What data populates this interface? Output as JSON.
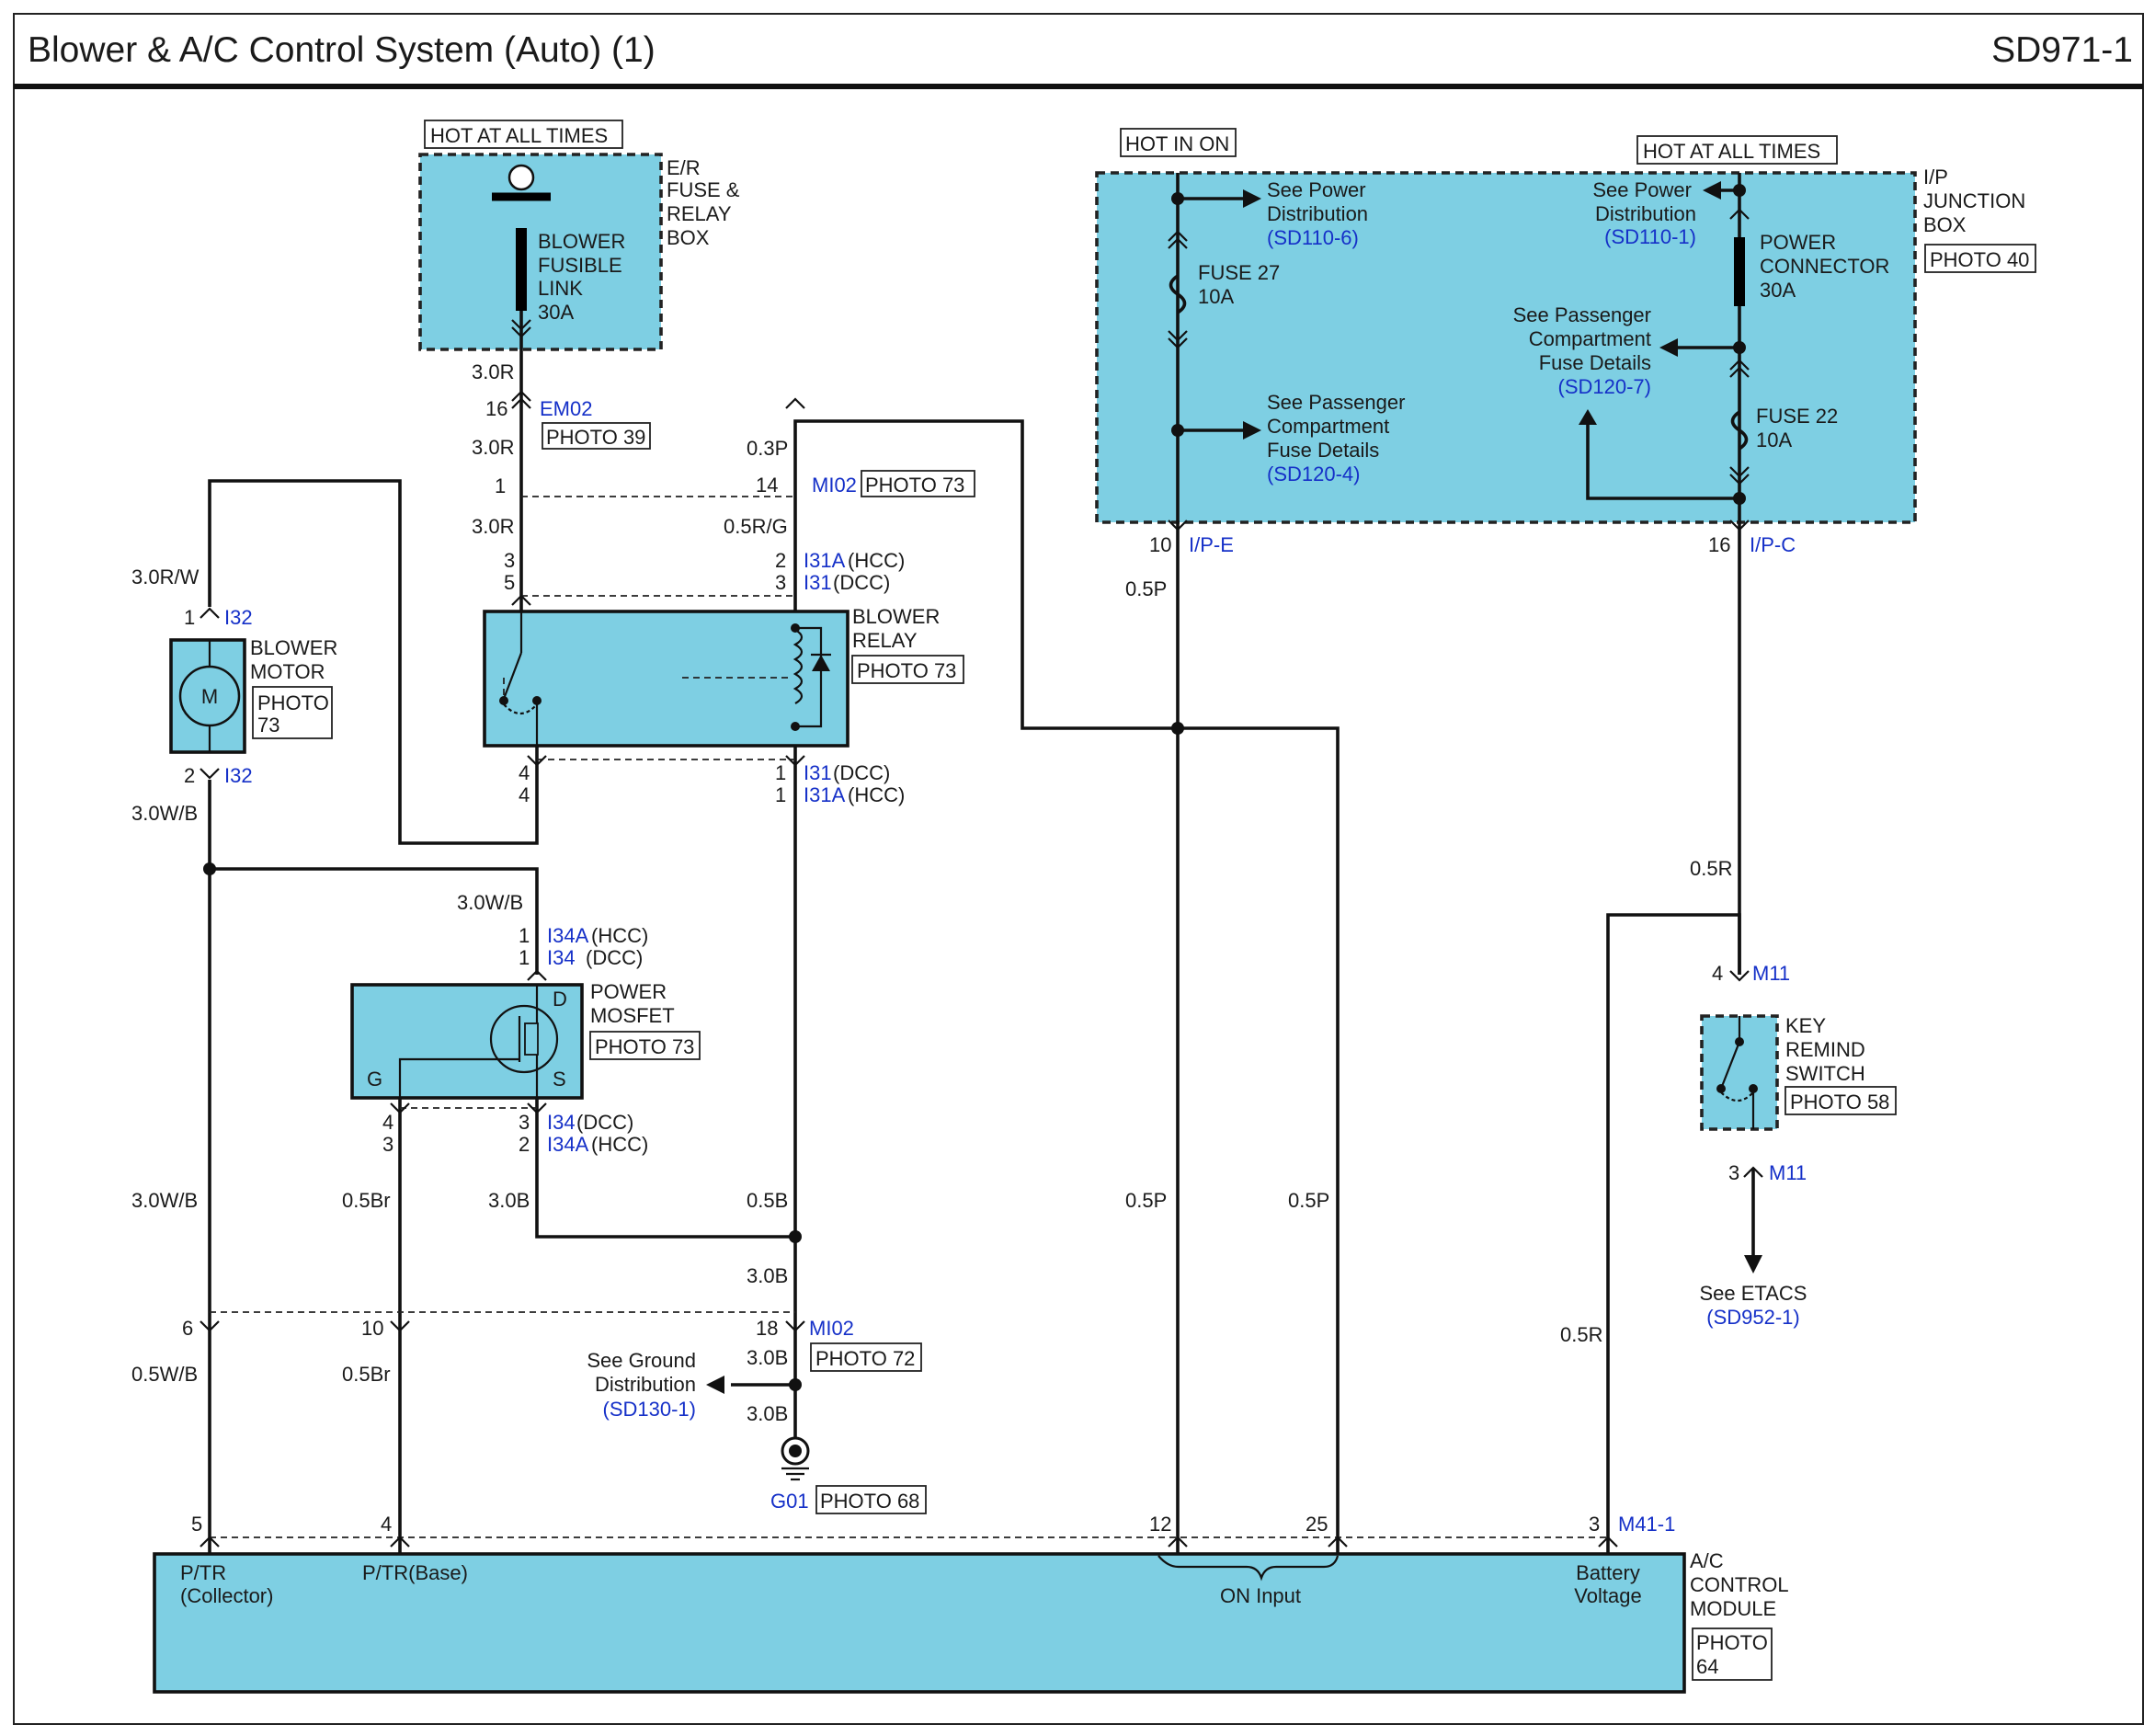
{
  "header": {
    "title": "Blower & A/C Control System (Auto) (1)",
    "page_code": "SD971-1"
  },
  "labels": {
    "hot_at_all_times": "HOT AT ALL TIMES",
    "hot_in_on": "HOT IN ON",
    "photo_39": "PHOTO 39",
    "photo_73": "PHOTO 73",
    "photo_40": "PHOTO 40",
    "photo_58": "PHOTO 58",
    "photo_72": "PHOTO 72",
    "photo_68": "PHOTO 68",
    "photo": "PHOTO",
    "n73": "73",
    "n64": "64",
    "er_1": "E/R",
    "er_2": "FUSE &",
    "er_3": "RELAY",
    "er_4": "BOX",
    "bfl_1": "BLOWER",
    "bfl_2": "FUSIBLE",
    "bfl_3": "LINK",
    "bfl_4": "30A",
    "ip_1": "I/P",
    "ip_2": "JUNCTION",
    "ip_3": "BOX",
    "see_power": "See Power",
    "distribution": "Distribution",
    "sd110_6": "(SD110-6)",
    "sd110_1": "(SD110-1)",
    "fuse27": "FUSE 27",
    "fuse22": "FUSE 22",
    "a10": "10A",
    "a30": "30A",
    "power": "POWER",
    "connector": "CONNECTOR",
    "see_passenger": "See Passenger",
    "compartment": "Compartment",
    "fuse_details": "Fuse Details",
    "sd120_4": "(SD120-4)",
    "sd120_7": "(SD120-7)",
    "blower": "BLOWER",
    "relay": "RELAY",
    "motor": "MOTOR",
    "m": "M",
    "power_up": "POWER",
    "mosfet": "MOSFET",
    "d": "D",
    "g": "G",
    "s": "S",
    "key": "KEY",
    "remind": "REMIND",
    "switch": "SWITCH",
    "see_etacs": "See ETACS",
    "sd952_1": "(SD952-1)",
    "see_ground": "See Ground",
    "sd130_1": "(SD130-1)",
    "ptr": "P/TR",
    "collector": "(Collector)",
    "ptr_base": "P/TR(Base)",
    "on_input": "ON Input",
    "battery": "Battery",
    "voltage": "Voltage",
    "ac": "A/C",
    "control": "CONTROL",
    "module": "MODULE",
    "hcc": "(HCC)",
    "dcc": "(DCC)"
  },
  "wires": {
    "w30R": "3.0R",
    "w03P": "0.3P",
    "w05RG": "0.5R/G",
    "w30RW": "3.0R/W",
    "w30WB": "3.0W/B",
    "w05Br": "0.5Br",
    "w30B": "3.0B",
    "w05B": "0.5B",
    "w05P": "0.5P",
    "w05R": "0.5R",
    "w05WB": "0.5W/B"
  },
  "connectors": {
    "EM02": "EM02",
    "MI02": "MI02",
    "I31A": "I31A",
    "I31": "I31",
    "I32": "I32",
    "I34A": "I34A",
    "I34": "I34",
    "IPE": "I/P-E",
    "IPC": "I/P-C",
    "M11": "M11",
    "G01": "G01",
    "M41": "M41-1"
  },
  "pins": {
    "p1": "1",
    "p2": "2",
    "p3": "3",
    "p4": "4",
    "p5": "5",
    "p6": "6",
    "p10": "10",
    "p12": "12",
    "p14": "14",
    "p16": "16",
    "p18": "18",
    "p25": "25"
  }
}
